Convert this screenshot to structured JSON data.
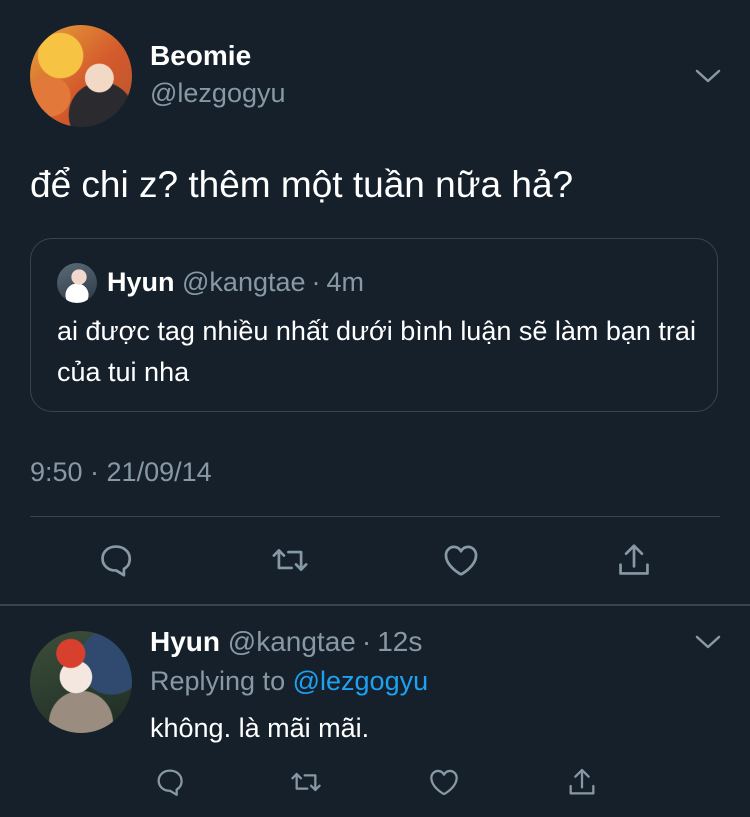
{
  "main_tweet": {
    "author_name": "Beomie",
    "author_handle": "@lezgogyu",
    "text": "để chi z? thêm một tuần nữa hả?",
    "quoted": {
      "author_name": "Hyun",
      "author_handle": "@kangtae",
      "separator": "·",
      "time": "4m",
      "text": "ai được tag nhiều nhất dưới bình luận sẽ làm bạn trai của tui nha"
    },
    "timestamp": "9:50 · 21/09/14",
    "actions": [
      "reply-icon",
      "retweet-icon",
      "like-icon",
      "share-icon"
    ]
  },
  "reply_tweet": {
    "author_name": "Hyun",
    "author_handle": "@kangtae",
    "separator": "·",
    "time": "12s",
    "replying_prefix": "Replying to",
    "replying_to": "@lezgogyu",
    "text": "không. là mãi mãi.",
    "actions": [
      "reply-icon",
      "retweet-icon",
      "like-icon",
      "share-icon"
    ]
  },
  "colors": {
    "background": "#15202b",
    "text": "#ffffff",
    "muted": "#8899a6",
    "border": "#38444d",
    "link": "#1da1f2"
  }
}
